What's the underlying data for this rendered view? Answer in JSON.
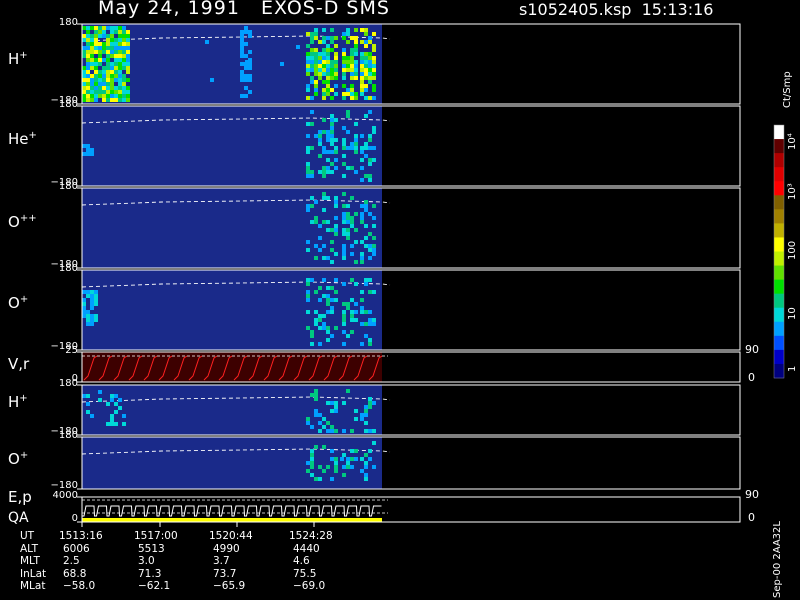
{
  "header": {
    "title": "May 24, 1991   EXOS-D SMS",
    "file": "s1052405.ksp",
    "time": "15:13:16"
  },
  "panels": [
    {
      "id": "h1",
      "species": "H",
      "charge": "+",
      "ticks": [
        "180",
        "−180"
      ]
    },
    {
      "id": "he",
      "species": "He",
      "charge": "+",
      "ticks": [
        "180",
        "−180"
      ]
    },
    {
      "id": "o2",
      "species": "O",
      "charge": "++",
      "ticks": [
        "180",
        "−180"
      ]
    },
    {
      "id": "o1",
      "species": "O",
      "charge": "+",
      "ticks": [
        "180",
        "−180"
      ]
    },
    {
      "id": "vr",
      "species": "V,r",
      "charge": "",
      "ticks": [
        "25",
        "0"
      ],
      "right_ticks": [
        "90",
        "0"
      ]
    },
    {
      "id": "h2",
      "species": "H",
      "charge": "+",
      "ticks": [
        "180",
        "−180"
      ]
    },
    {
      "id": "o3",
      "species": "O",
      "charge": "+",
      "ticks": [
        "180",
        "−180"
      ]
    },
    {
      "id": "ep",
      "species": "E,p",
      "species2": "QA",
      "charge": "",
      "ticks": [
        "4000",
        "0"
      ],
      "right_ticks": [
        "90",
        "0"
      ]
    }
  ],
  "colorbar": {
    "unit": "Ct/Smp",
    "ticks": [
      "1",
      "10",
      "100",
      "10³",
      "10⁴"
    ],
    "colors": [
      "#000080",
      "#0000c8",
      "#0050ff",
      "#00a0ff",
      "#00d8d8",
      "#00c880",
      "#00e000",
      "#60e000",
      "#c0f000",
      "#ffff00",
      "#c0b000",
      "#a08000",
      "#806000",
      "#ff0000",
      "#e00000",
      "#b00000",
      "#600000",
      "#ffffff"
    ]
  },
  "chart_data": {
    "type": "heatmap",
    "title": "May 24, 1991   EXOS-D SMS",
    "xlabel": "UT",
    "x": [
      "1513:16",
      "1517:00",
      "1520:44",
      "1524:28"
    ],
    "rows": [
      {
        "label": "UT",
        "values": [
          "1513:16",
          "1517:00",
          "1520:44",
          "1524:28"
        ]
      },
      {
        "label": "ALT",
        "values": [
          "6006",
          "5513",
          "4990",
          "4440"
        ]
      },
      {
        "label": "MLT",
        "values": [
          "2.5",
          "3.0",
          "3.7",
          "4.6"
        ]
      },
      {
        "label": "InLat",
        "values": [
          "68.8",
          "71.3",
          "73.7",
          "75.5"
        ]
      },
      {
        "label": "MLat",
        "values": [
          "−58.0",
          "−62.1",
          "−65.9",
          "−69.0"
        ]
      }
    ],
    "series": [
      {
        "name": "H+",
        "ylim": [
          -180,
          180
        ]
      },
      {
        "name": "He+",
        "ylim": [
          -180,
          180
        ]
      },
      {
        "name": "O++",
        "ylim": [
          -180,
          180
        ]
      },
      {
        "name": "O+",
        "ylim": [
          -180,
          180
        ]
      },
      {
        "name": "V,r",
        "ylim": [
          0,
          25
        ]
      },
      {
        "name": "H+",
        "ylim": [
          -180,
          180
        ]
      },
      {
        "name": "O+",
        "ylim": [
          -180,
          180
        ]
      },
      {
        "name": "E,p",
        "ylim": [
          0,
          4000
        ]
      }
    ],
    "colorbar_range": [
      1,
      10000
    ],
    "log_scale_colorbar": true
  },
  "footer": {
    "stamp": "Sep-00 2AA32L"
  }
}
